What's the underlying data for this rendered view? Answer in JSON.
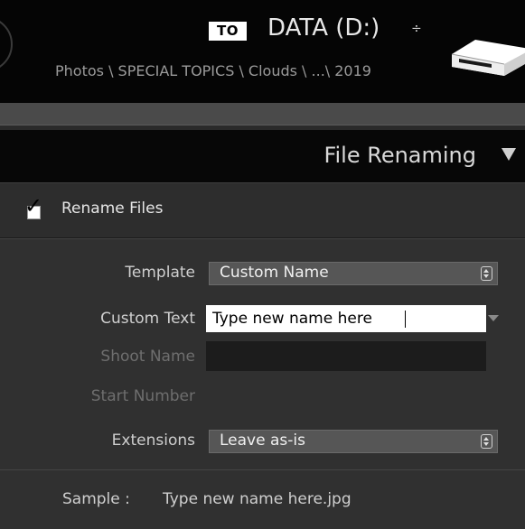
{
  "destination": {
    "to_badge": "TO",
    "volume": "DATA (D:)",
    "volume_arrows": "÷",
    "path": "Photos \\ SPECIAL TOPICS \\ Clouds \\ ...\\ 2019",
    "icons": {
      "drive": "hard-drive-icon",
      "nav": "circle-button"
    }
  },
  "panel": {
    "title": "File Renaming",
    "collapse_icon": "triangle-down-icon"
  },
  "rename_files": {
    "label": "Rename Files",
    "checked": true
  },
  "fields": {
    "template": {
      "label": "Template",
      "value": "Custom Name"
    },
    "custom_text": {
      "label": "Custom Text",
      "value": "Type new name here"
    },
    "shoot_name": {
      "label": "Shoot Name",
      "value": ""
    },
    "start_number": {
      "label": "Start Number"
    },
    "extensions": {
      "label": "Extensions",
      "value": "Leave as-is"
    }
  },
  "sample": {
    "label": "Sample :",
    "value": "Type new name here.jpg"
  }
}
